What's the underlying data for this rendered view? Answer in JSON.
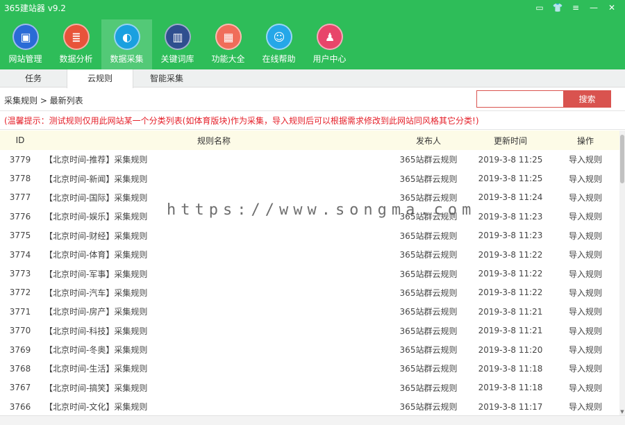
{
  "app": {
    "title": "365建站器 v9.2",
    "window_controls": [
      "▭",
      "👕",
      "≡",
      "—",
      "✕"
    ]
  },
  "nav": {
    "items": [
      {
        "label": "网站管理",
        "icon": "monitor-icon",
        "glyph": "▣",
        "color": "#2a6bd6"
      },
      {
        "label": "数据分析",
        "icon": "database-icon",
        "glyph": "≣",
        "color": "#e8533a"
      },
      {
        "label": "数据采集",
        "icon": "globe-icon",
        "glyph": "◐",
        "color": "#1aa0e0"
      },
      {
        "label": "关键词库",
        "icon": "book-icon",
        "glyph": "▥",
        "color": "#2f4f8f"
      },
      {
        "label": "功能大全",
        "icon": "apps-icon",
        "glyph": "▦",
        "color": "#f06d5a"
      },
      {
        "label": "在线帮助",
        "icon": "chat-icon",
        "glyph": "☺",
        "color": "#25a7e8"
      },
      {
        "label": "用户中心",
        "icon": "user-icon",
        "glyph": "♟",
        "color": "#e8456a"
      }
    ],
    "active_index": 2
  },
  "tabs": [
    "任务",
    "云规则",
    "智能采集"
  ],
  "active_tab": 1,
  "breadcrumb": "采集规则 > 最新列表",
  "search": {
    "placeholder": "",
    "button_label": "搜索"
  },
  "notice": "(温馨提示：测试规则仅用此网站某一个分类列表(如体育版块)作为采集，导入规则后可以根据需求修改到此网站同风格其它分类!)",
  "table": {
    "headers": [
      "ID",
      "规则名称",
      "发布人",
      "更新时间",
      "操作"
    ],
    "rows": [
      {
        "id": "3779",
        "name": "【北京时间-推荐】采集规则",
        "publisher": "365站群云规则",
        "time": "2019-3-8 11:25",
        "action": "导入规则"
      },
      {
        "id": "3778",
        "name": "【北京时间-新闻】采集规则",
        "publisher": "365站群云规则",
        "time": "2019-3-8 11:25",
        "action": "导入规则"
      },
      {
        "id": "3777",
        "name": "【北京时间-国际】采集规则",
        "publisher": "365站群云规则",
        "time": "2019-3-8 11:24",
        "action": "导入规则"
      },
      {
        "id": "3776",
        "name": "【北京时间-娱乐】采集规则",
        "publisher": "365站群云规则",
        "time": "2019-3-8 11:23",
        "action": "导入规则"
      },
      {
        "id": "3775",
        "name": "【北京时间-财经】采集规则",
        "publisher": "365站群云规则",
        "time": "2019-3-8 11:23",
        "action": "导入规则"
      },
      {
        "id": "3774",
        "name": "【北京时间-体育】采集规则",
        "publisher": "365站群云规则",
        "time": "2019-3-8 11:22",
        "action": "导入规则"
      },
      {
        "id": "3773",
        "name": "【北京时间-军事】采集规则",
        "publisher": "365站群云规则",
        "time": "2019-3-8 11:22",
        "action": "导入规则"
      },
      {
        "id": "3772",
        "name": "【北京时间-汽车】采集规则",
        "publisher": "365站群云规则",
        "time": "2019-3-8 11:22",
        "action": "导入规则"
      },
      {
        "id": "3771",
        "name": "【北京时间-房产】采集规则",
        "publisher": "365站群云规则",
        "time": "2019-3-8 11:21",
        "action": "导入规则"
      },
      {
        "id": "3770",
        "name": "【北京时间-科技】采集规则",
        "publisher": "365站群云规则",
        "time": "2019-3-8 11:21",
        "action": "导入规则"
      },
      {
        "id": "3769",
        "name": "【北京时间-冬奥】采集规则",
        "publisher": "365站群云规则",
        "time": "2019-3-8 11:20",
        "action": "导入规则"
      },
      {
        "id": "3768",
        "name": "【北京时间-生活】采集规则",
        "publisher": "365站群云规则",
        "time": "2019-3-8 11:18",
        "action": "导入规则"
      },
      {
        "id": "3767",
        "name": "【北京时间-搞笑】采集规则",
        "publisher": "365站群云规则",
        "time": "2019-3-8 11:18",
        "action": "导入规则"
      },
      {
        "id": "3766",
        "name": "【北京时间-文化】采集规则",
        "publisher": "365站群云规则",
        "time": "2019-3-8 11:17",
        "action": "导入规则"
      }
    ]
  },
  "watermark": "https://www.songma.com"
}
